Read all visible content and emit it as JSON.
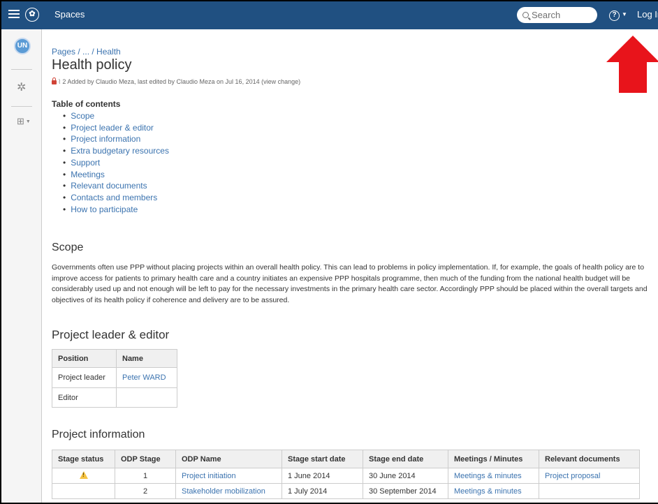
{
  "topbar": {
    "spaces_label": "Spaces",
    "search_placeholder": "Search",
    "help_label": "?",
    "login_label": "Log In"
  },
  "sidebar": {
    "logo_label": "UN"
  },
  "page": {
    "breadcrumb": "Pages / ... / Health",
    "title": "Health policy",
    "meta": "2 Added by Claudio Meza, last edited by Claudio Meza on Jul 16, 2014 (view change)",
    "toc_title": "Table of contents",
    "toc": [
      "Scope",
      "Project leader & editor",
      "Project information",
      "Extra budgetary resources",
      "Support",
      "Meetings",
      "Relevant documents",
      "Contacts and members",
      "How to participate"
    ],
    "scope_heading": "Scope",
    "scope_text": "Governments often use PPP without placing projects within an overall health policy. This can lead to problems in policy implementation. If, for example, the goals of health policy are to improve access for patients to primary health care and a country initiates an expensive PPP hospitals programme, then much of the funding from the national health budget will be considerably used up and not enough will be left to pay for the necessary investments in the primary health care sector. Accordingly PPP should be placed within the overall targets and objectives of its health policy if coherence and delivery are to be assured.",
    "leader_heading": "Project leader & editor",
    "leader_table": {
      "headers": [
        "Position",
        "Name"
      ],
      "rows": [
        [
          "Project leader",
          "Peter WARD"
        ],
        [
          "Editor",
          ""
        ]
      ]
    },
    "info_heading": "Project information",
    "info_table": {
      "headers": [
        "Stage status",
        "ODP Stage",
        "ODP Name",
        "Stage start date",
        "Stage end date",
        "Meetings / Minutes",
        "Relevant documents"
      ],
      "rows": [
        [
          "warning",
          "1",
          "Project initiation",
          "1 June 2014",
          "30 June 2014",
          "Meetings & minutes",
          "Project proposal"
        ],
        [
          "",
          "2",
          "Stakeholder mobilization",
          "1 July 2014",
          "30 September 2014",
          "Meetings & minutes",
          ""
        ]
      ]
    }
  },
  "colors": {
    "header_bg": "#205081",
    "link": "#3b73af",
    "arrow": "#e8141b",
    "warning": "#f6c342"
  }
}
